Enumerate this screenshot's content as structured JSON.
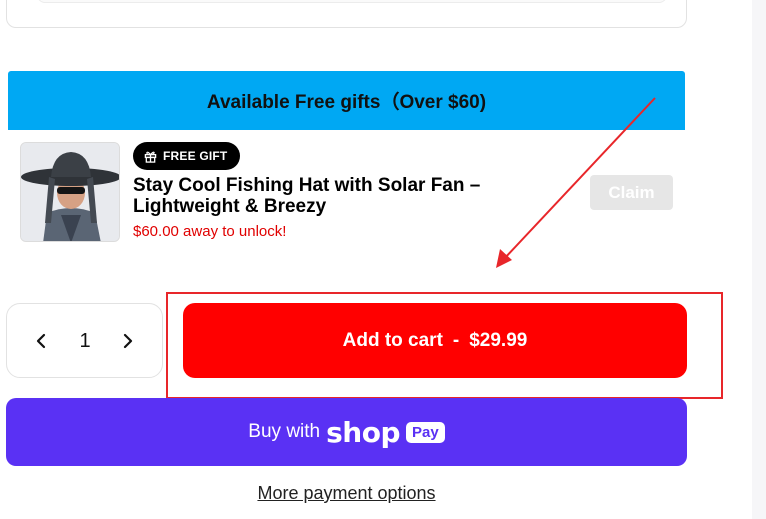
{
  "free_gifts": {
    "banner_title": "Available Free gifts（Over $60)",
    "gift": {
      "badge_label": "FREE GIFT",
      "badge_icon": "gift-icon",
      "title": "Stay Cool Fishing Hat with Solar Fan – Lightweight & Breezy",
      "unlock_text": "$60.00 away to unlock!",
      "claim_label": "Claim",
      "claim_state": "disabled"
    }
  },
  "purchase": {
    "quantity": "1",
    "decrease_icon": "chevron-left-icon",
    "increase_icon": "chevron-right-icon",
    "add_to_cart_label": "Add to cart",
    "separator": "-",
    "price": "$29.99"
  },
  "shop_pay": {
    "buy_with": "Buy with",
    "shop_word": "shop",
    "pay_word": "Pay"
  },
  "more_payment_options": "More payment options",
  "colors": {
    "banner": "#00a8f3",
    "add_to_cart": "#ff0000",
    "shop_pay": "#5a31f4",
    "unlock_text": "#e00000",
    "annotation": "#e8262a"
  }
}
